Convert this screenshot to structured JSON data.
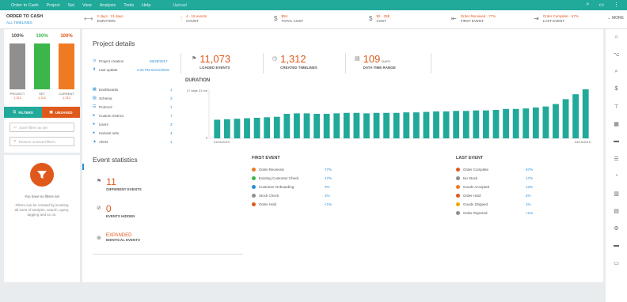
{
  "topbar": {
    "menu": [
      "Order to Cash",
      "Project",
      "Set",
      "View",
      "Analysis",
      "Tools",
      "Help"
    ],
    "upload": "Upload"
  },
  "filterbar": {
    "title": "ORDER TO CASH",
    "subtitle": "ALL TIMELINES",
    "segments": [
      {
        "icon": "duration-icon",
        "value": "2 days · 21 days",
        "label": "DURATION"
      },
      {
        "icon": "count-icon",
        "value": "4 · 15 events",
        "label": "COUNT"
      },
      {
        "icon": "dollar-icon",
        "value": "$5K",
        "label": "TOTAL COST"
      },
      {
        "icon": "dollar-icon",
        "value": "$2 · 25$",
        "label": "COST"
      },
      {
        "icon": "first-event-icon",
        "value": "Order Received · 77%",
        "label": "FIRST EVENT"
      },
      {
        "icon": "last-event-icon",
        "value": "Order Complete · 67%",
        "label": "LAST EVENT"
      }
    ],
    "more": "MORE"
  },
  "left_panel": {
    "bars": [
      {
        "pct": "100%",
        "label": "PROJECT",
        "value": "1,312",
        "color": "#8f8f8f"
      },
      {
        "pct": "100%",
        "label": "SET",
        "value": "1,312",
        "color": "#3cb54a"
      },
      {
        "pct": "100%",
        "label": "CURRENT",
        "value": "1,312",
        "color": "#f07a22"
      }
    ],
    "filters_label": "FILTERS",
    "unsaved_label": "UNSAVED",
    "search_placeholder": "Save filters as set",
    "restore_placeholder": "Restore unsaved filters",
    "no_filter_title": "You have no filters set",
    "no_filter_desc": "Filters can be created by invoking all sorts of analysis, search, query, tagging and so on."
  },
  "project_details": {
    "title": "Project details",
    "creation_label": "Project creation",
    "creation_value": "06/28/2017",
    "update_label": "Last update",
    "update_value": "2:24 PM 01/21/2019",
    "items": [
      {
        "label": "Dashboards",
        "count": "1"
      },
      {
        "label": "Schema",
        "count": "3"
      },
      {
        "label": "Protocol",
        "count": "1"
      },
      {
        "label": "Custom metrics",
        "count": "7"
      },
      {
        "label": "Users",
        "count": "3"
      },
      {
        "label": "Harvest sets",
        "count": "4"
      },
      {
        "label": "Alerts",
        "count": "1"
      }
    ]
  },
  "metrics": [
    {
      "value": "11,073",
      "unit": "",
      "label": "LOADED EVENTS"
    },
    {
      "value": "1,312",
      "unit": "",
      "label": "CREATED TIMELINES"
    },
    {
      "value": "109",
      "unit": "DAYS",
      "label": "DATA TIME RANGE"
    }
  ],
  "duration": {
    "title": "DURATION",
    "chart_data": {
      "type": "bar",
      "ymax_label": "17 days 21 hrs",
      "ymin_label": "0",
      "x_start_label": "01/01/2019",
      "x_end_label": "04/10/2019",
      "values": [
        0.38,
        0.39,
        0.4,
        0.41,
        0.42,
        0.43,
        0.44,
        0.5,
        0.51,
        0.51,
        0.5,
        0.5,
        0.51,
        0.52,
        0.52,
        0.51,
        0.52,
        0.52,
        0.52,
        0.53,
        0.53,
        0.54,
        0.55,
        0.55,
        0.56,
        0.56,
        0.57,
        0.57,
        0.58,
        0.6,
        0.6,
        0.61,
        0.63,
        0.65,
        0.7,
        0.8,
        0.9,
        1.0
      ],
      "color": "#21a99a"
    }
  },
  "event_statistics": {
    "title": "Event statistics",
    "different_events_value": "11",
    "different_events_label": "DIFFERENT EVENTS",
    "events_hidden_value": "0",
    "events_hidden_label": "EVENTS HIDDEN",
    "identical_value": "EXPANDED",
    "identical_label": "IDENTICAL EVENTS"
  },
  "first_event": {
    "title": "FIRST EVENT",
    "rows": [
      {
        "label": "Order Received",
        "pct": "77%",
        "color": "#f07a22"
      },
      {
        "label": "Existing Customer Check",
        "pct": "17%",
        "color": "#3cb54a"
      },
      {
        "label": "Customer Onboarding",
        "pct": "3%",
        "color": "#2a8fd6"
      },
      {
        "label": "Stock Check",
        "pct": "2%",
        "color": "#8f8f8f"
      },
      {
        "label": "Order Hold",
        "pct": "<1%",
        "color": "#e0591c"
      }
    ]
  },
  "last_event": {
    "title": "LAST EVENT",
    "rows": [
      {
        "label": "Order Complete",
        "pct": "67%",
        "color": "#e0591c"
      },
      {
        "label": "No Stock",
        "pct": "17%",
        "color": "#8f8f8f"
      },
      {
        "label": "Goods Accepted",
        "pct": "12%",
        "color": "#f07a22"
      },
      {
        "label": "Order Hold",
        "pct": "2%",
        "color": "#e0591c"
      },
      {
        "label": "Goods Shipped",
        "pct": "1%",
        "color": "#f0a800"
      },
      {
        "label": "Order Rejected",
        "pct": "<1%",
        "color": "#8f8f8f"
      }
    ]
  }
}
